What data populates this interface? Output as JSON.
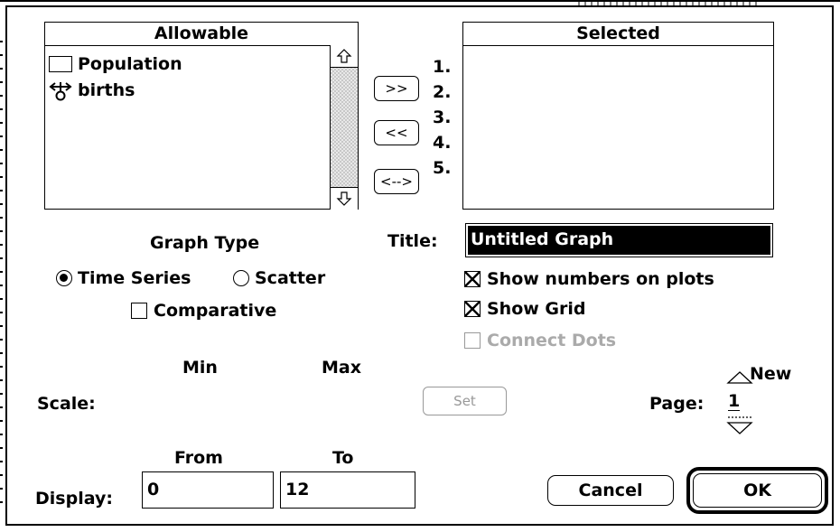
{
  "allowable": {
    "header": "Allowable",
    "items": [
      {
        "label": "Population",
        "icon": "stock-box-icon"
      },
      {
        "label": "births",
        "icon": "flow-valve-icon"
      }
    ]
  },
  "move_buttons": {
    "add": ">>",
    "remove": "<<",
    "swap": "<-->"
  },
  "slot_numbers": [
    "1.",
    "2.",
    "3.",
    "4.",
    "5."
  ],
  "selected": {
    "header": "Selected",
    "items": []
  },
  "graph_type": {
    "heading": "Graph Type",
    "time_series": "Time Series",
    "scatter": "Scatter",
    "comparative": "Comparative",
    "selected": "Time Series"
  },
  "title": {
    "label": "Title:",
    "value": "Untitled Graph"
  },
  "options": {
    "show_numbers": "Show numbers on plots",
    "show_grid": "Show Grid",
    "connect_dots": "Connect Dots"
  },
  "scale": {
    "label": "Scale:",
    "min_header": "Min",
    "max_header": "Max",
    "set_button": "Set"
  },
  "page": {
    "label": "Page:",
    "value": "1",
    "new_label": "New"
  },
  "display": {
    "label": "Display:",
    "from_header": "From",
    "to_header": "To",
    "from_value": "0",
    "to_value": "12"
  },
  "buttons": {
    "cancel": "Cancel",
    "ok": "OK"
  }
}
